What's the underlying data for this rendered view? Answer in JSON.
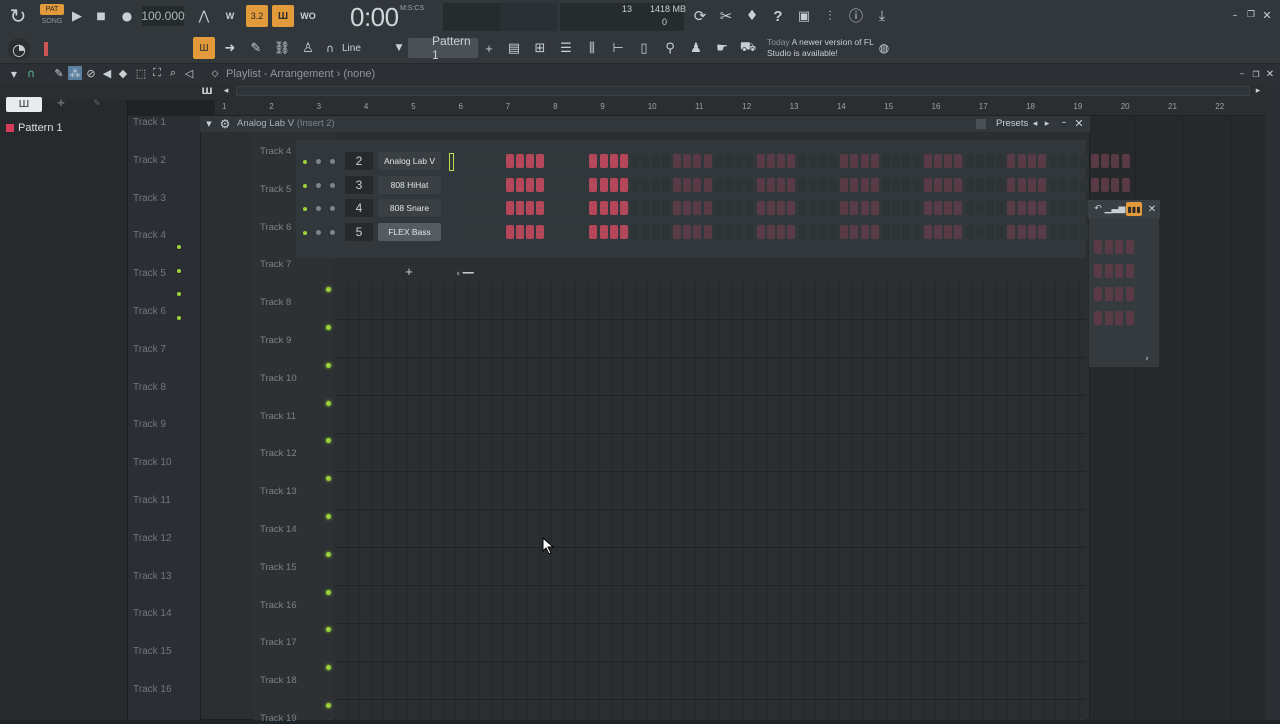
{
  "toolbar": {
    "pat_label": "PAT",
    "song_label": "SONG",
    "tempo": "100.000",
    "time": "0:00",
    "time_unit": "M:S:CS",
    "cpu_value": "13",
    "memory": "1418 MB",
    "polyphony": "0",
    "snap_value": "Line",
    "pattern_name": "Pattern 1",
    "news_time": "Today",
    "news_text": "A newer version of FL Studio is available!"
  },
  "playlist": {
    "title": "Playlist - Arrangement",
    "sub": "(none)",
    "ruler": [
      "1",
      "2",
      "3",
      "4",
      "5",
      "6",
      "7",
      "8",
      "9",
      "10",
      "11",
      "12",
      "13",
      "14",
      "15",
      "16",
      "17",
      "18",
      "19",
      "20",
      "21",
      "22"
    ]
  },
  "browser": {
    "tab_icon": "piano-roll-icon",
    "pattern_item": "Pattern 1"
  },
  "arrangement_tracks": [
    "Track 1",
    "Track 2",
    "Track 3",
    "Track 4",
    "Track 5",
    "Track 6",
    "Track 7",
    "Track 8",
    "Track 9",
    "Track 10",
    "Track 11",
    "Track 12",
    "Track 13",
    "Track 14",
    "Track 15",
    "Track 16"
  ],
  "channel_rack": {
    "title": "Analog Lab V",
    "insert": "(Insert 2)",
    "presets_label": "Presets",
    "channels": [
      {
        "num": "2",
        "name": "Analog Lab V"
      },
      {
        "num": "3",
        "name": "808 HiHat"
      },
      {
        "num": "4",
        "name": "808 Snare"
      },
      {
        "num": "5",
        "name": "FLEX Bass"
      }
    ],
    "tracks": [
      "Track 4",
      "Track 5",
      "Track 6",
      "Track 7",
      "Track 8",
      "Track 9",
      "Track 10",
      "Track 11",
      "Track 12",
      "Track 13",
      "Track 14",
      "Track 15",
      "Track 16",
      "Track 17",
      "Track 18",
      "Track 19"
    ]
  },
  "colors": {
    "accent_orange": "#e39a3a",
    "led_green": "#9bd13a",
    "step_on": "#b5475a"
  }
}
